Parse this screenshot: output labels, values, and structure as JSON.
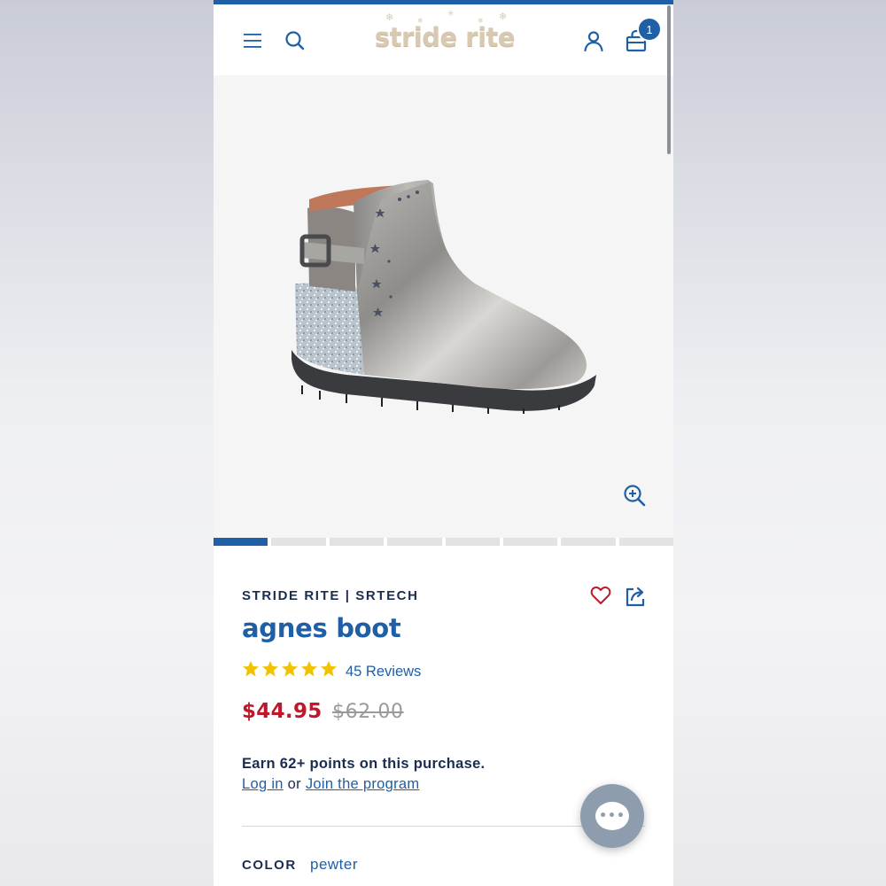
{
  "header": {
    "logo_text": "stride rite",
    "cart_count": "1",
    "accent_color": "#1f5fa6"
  },
  "gallery": {
    "image_count": 8,
    "active_index": 0
  },
  "product": {
    "brand": "STRIDE RITE | SRTECH",
    "title": "agnes boot",
    "rating": 5,
    "reviews_label": "45 Reviews",
    "sale_price": "$44.95",
    "original_price": "$62.00",
    "sale_color": "#c0182a"
  },
  "loyalty": {
    "earn_text": "Earn 62+ points on this purchase.",
    "login_label": "Log in",
    "or_text": "or",
    "join_label": "Join the program"
  },
  "color": {
    "label": "COLOR",
    "value": "pewter"
  },
  "icons": [
    "menu-icon",
    "search-icon",
    "account-icon",
    "bag-icon",
    "zoom-icon",
    "heart-icon",
    "share-icon",
    "chat-icon"
  ]
}
